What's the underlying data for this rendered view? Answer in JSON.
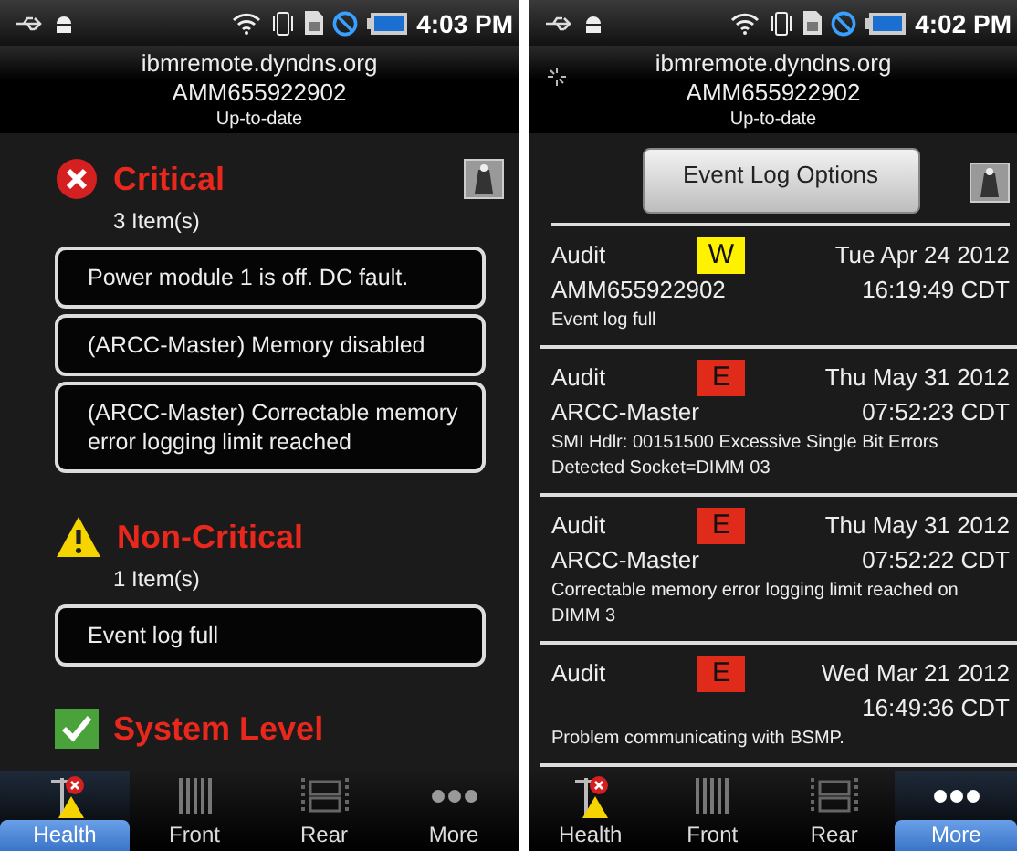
{
  "screens": [
    {
      "kind": "health",
      "status_bar": {
        "time": "4:03 PM"
      },
      "header": {
        "host": "ibmremote.dyndns.org",
        "serial": "AMM655922902",
        "status": "Up-to-date"
      },
      "sections": [
        {
          "kind": "critical",
          "title": "Critical",
          "count": "3 Item(s)",
          "items": [
            "Power module 1 is off. DC fault.",
            "(ARCC-Master) Memory disabled",
            "(ARCC-Master) Correctable memory error logging limit reached"
          ]
        },
        {
          "kind": "warning",
          "title": "Non-Critical",
          "count": "1 Item(s)",
          "items": [
            "Event log full"
          ]
        },
        {
          "kind": "ok",
          "title": "System Level"
        }
      ],
      "tabs": [
        {
          "label": "Health",
          "selected": true
        },
        {
          "label": "Front",
          "selected": false
        },
        {
          "label": "Rear",
          "selected": false
        },
        {
          "label": "More",
          "selected": false
        }
      ]
    },
    {
      "kind": "event_log",
      "status_bar": {
        "time": "4:02 PM"
      },
      "header": {
        "host": "ibmremote.dyndns.org",
        "serial": "AMM655922902",
        "status": "Up-to-date",
        "loading": true
      },
      "options_button": "Event Log Options",
      "entries": [
        {
          "type": "Audit",
          "severity": "W",
          "color": "#fff200",
          "date": "Tue Apr 24 2012",
          "source": "AMM655922902",
          "time": "16:19:49 CDT",
          "message": "Event log full"
        },
        {
          "type": "Audit",
          "severity": "E",
          "color": "#e02a1a",
          "date": "Thu May 31 2012",
          "source": "ARCC-Master",
          "time": "07:52:23 CDT",
          "message": "SMI Hdlr:   00151500 Excessive Single Bit Errors Detected  Socket=DIMM 03"
        },
        {
          "type": "Audit",
          "severity": "E",
          "color": "#e02a1a",
          "date": "Thu May 31 2012",
          "source": "ARCC-Master",
          "time": "07:52:22 CDT",
          "message": "Correctable memory error logging limit reached on DIMM 3"
        },
        {
          "type": "Audit",
          "severity": "E",
          "color": "#e02a1a",
          "date": "Wed Mar 21 2012",
          "time": "16:49:36 CDT",
          "message": "Problem communicating with BSMP."
        }
      ],
      "tabs": [
        {
          "label": "Health",
          "selected": false
        },
        {
          "label": "Front",
          "selected": false
        },
        {
          "label": "Rear",
          "selected": false
        },
        {
          "label": "More",
          "selected": true
        }
      ]
    }
  ]
}
